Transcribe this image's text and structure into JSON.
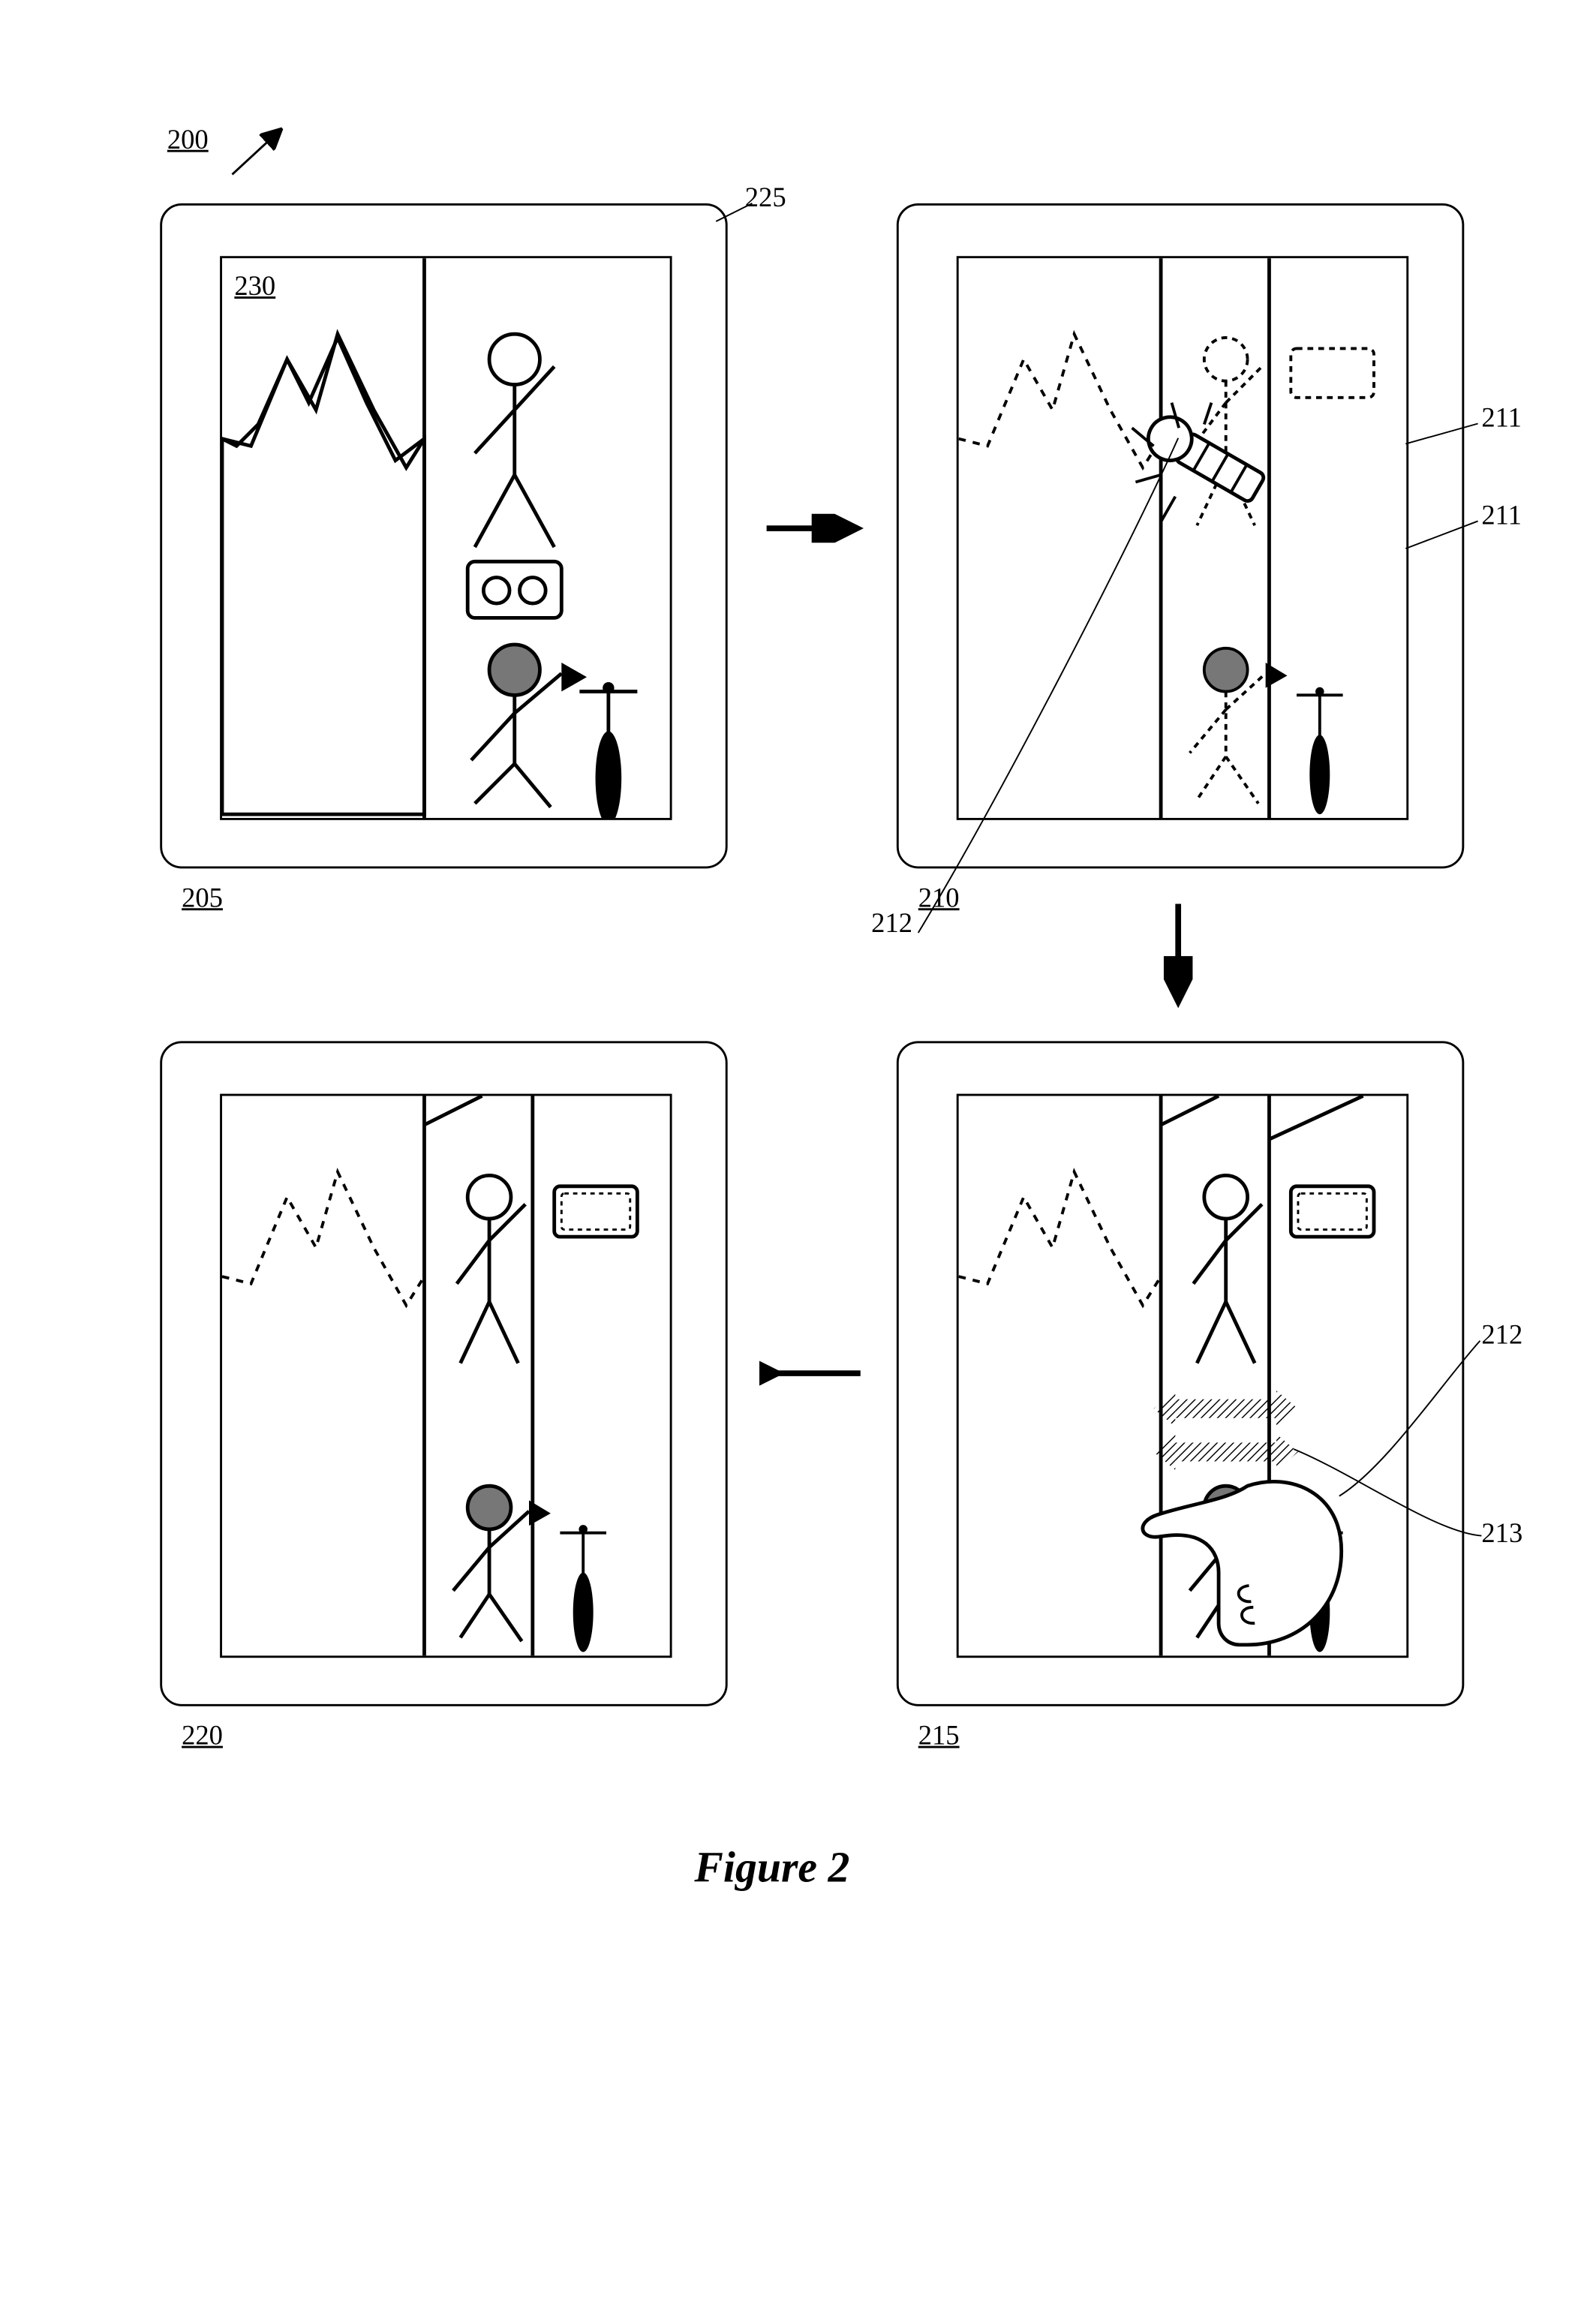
{
  "figure_label": "Figure 2",
  "ref": {
    "diagram": "200",
    "device": "225",
    "image": "230",
    "panel1": "205",
    "panel2": "210",
    "panel3": "215",
    "panel4": "220",
    "row_a": "211",
    "row_b": "211",
    "hand_a": "212",
    "hand_b": "212",
    "arrows": "213"
  }
}
